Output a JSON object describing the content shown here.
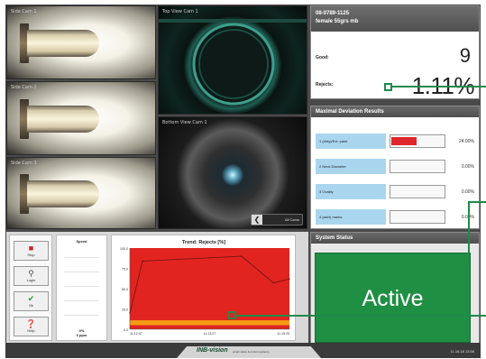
{
  "cameras": {
    "side": [
      "Side Cam 1",
      "Side Cam 2",
      "Side Cam 3"
    ],
    "top": "Top View Cam 1",
    "bottom": "Bottom View Cam 1",
    "nav_label": "All Cams"
  },
  "counts": {
    "job_id": "08-0789-1125",
    "product": "female 55grs mb",
    "good_label": "Good:",
    "good_value": "9",
    "rejects_label": "Rejects:",
    "rejects_value": "1.11%"
  },
  "deviation": {
    "title": "Maximal Deviation Results",
    "rows": [
      {
        "label": "1 (dirty)/Ext. paint",
        "pct": "24.00%",
        "fill": 0.5
      },
      {
        "label": "2 Neck Diameter",
        "pct": "0.00%",
        "fill": 0
      },
      {
        "label": "3 Ovality",
        "pct": "0.00%",
        "fill": 0
      },
      {
        "label": "4 (skirt) marks",
        "pct": "0.00%",
        "fill": 0
      }
    ]
  },
  "status": {
    "title": "System Status",
    "value": "Active"
  },
  "toolbar": {
    "stop": "Stop",
    "login": "Login",
    "ok": "Ok",
    "help": "Help"
  },
  "speed": {
    "title": "Speed",
    "value": "0%",
    "unit": "0 ppm"
  },
  "chart_data": {
    "type": "area",
    "title": "Trend: Rejects [%]",
    "xlabel": "",
    "ylabel": "",
    "x": [
      "11:12:47",
      "11:13:27",
      "11:15:25"
    ],
    "y_ticks": [
      "0.0",
      "25.0",
      "50.0",
      "75.0",
      "100.0"
    ],
    "ylim": [
      0,
      100
    ],
    "series": [
      {
        "values": [
          [
            0,
            20
          ],
          [
            0.08,
            84
          ],
          [
            0.5,
            88
          ],
          [
            0.7,
            90
          ],
          [
            0.9,
            57
          ],
          [
            1,
            62
          ]
        ]
      }
    ],
    "bands": {
      "red": "#e1241f",
      "orange": "#f59a14"
    },
    "grid": false
  },
  "footer": {
    "brand": "INB-vision",
    "tagline": "smart vision & control systems",
    "datetime": "11.16.18 13:56"
  },
  "colors": {
    "accent_green": "#1f8f43",
    "header_gray": "#5a5a5a",
    "label_blue": "#a9d6ee"
  }
}
